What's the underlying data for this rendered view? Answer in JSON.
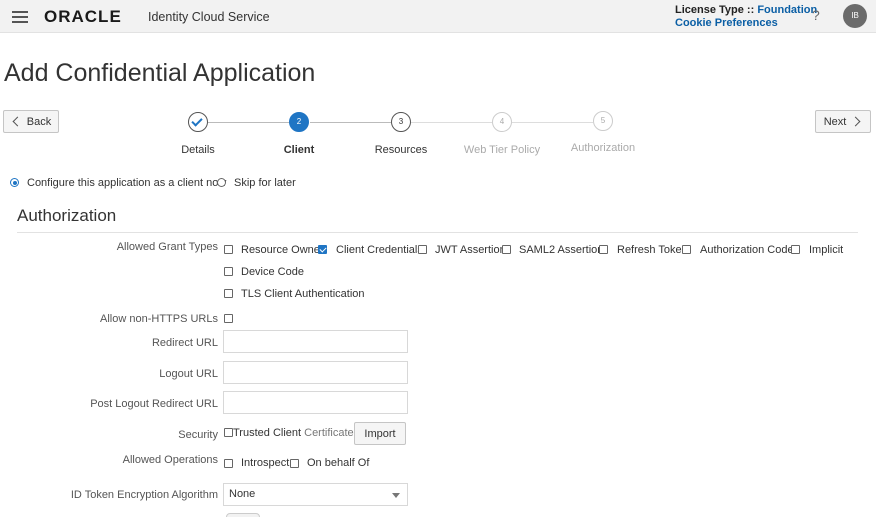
{
  "header": {
    "brand": "ORACLE",
    "service": "Identity Cloud Service",
    "license_label": "License Type :: ",
    "license_value": "Foundation",
    "cookie_link": "Cookie Preferences",
    "help": "?",
    "avatar_initials": "IB"
  },
  "page": {
    "title": "Add Confidential Application"
  },
  "nav": {
    "back": "Back",
    "next": "Next"
  },
  "steps": [
    {
      "number": "1",
      "label": "Details",
      "state": "done"
    },
    {
      "number": "2",
      "label": "Client",
      "state": "active"
    },
    {
      "number": "3",
      "label": "Resources",
      "state": "pending"
    },
    {
      "number": "4",
      "label": "Web Tier Policy",
      "state": "disabled"
    },
    {
      "number": "5",
      "label": "Authorization",
      "state": "disabled"
    }
  ],
  "client_choice": {
    "configure": "Configure this application as a client now",
    "skip": "Skip for later",
    "selected": "configure"
  },
  "authorization": {
    "title": "Authorization",
    "grant_types_label": "Allowed Grant Types",
    "grant_types": [
      {
        "label": "Resource Owner",
        "checked": false
      },
      {
        "label": "Client Credentials",
        "checked": true
      },
      {
        "label": "JWT Assertion",
        "checked": false
      },
      {
        "label": "SAML2 Assertion",
        "checked": false
      },
      {
        "label": "Refresh Token",
        "checked": false
      },
      {
        "label": "Authorization Code",
        "checked": false
      },
      {
        "label": "Implicit",
        "checked": false
      },
      {
        "label": "Device Code",
        "checked": false
      },
      {
        "label": "TLS Client Authentication",
        "checked": false
      }
    ],
    "non_https_label": "Allow non-HTTPS URLs",
    "redirect_url_label": "Redirect URL",
    "logout_url_label": "Logout URL",
    "post_logout_label": "Post Logout Redirect URL",
    "security_label": "Security",
    "trusted_client": "Trusted Client",
    "certificate": "Certificate",
    "import_button": "Import",
    "operations_label": "Allowed Operations",
    "operations": [
      {
        "label": "Introspect",
        "checked": false
      },
      {
        "label": "On behalf Of",
        "checked": false
      }
    ],
    "id_token_label": "ID Token Encryption Algorithm",
    "id_token_value": "None"
  },
  "colors": {
    "accent": "#1f75c4",
    "link": "#0b5fa5",
    "header_bg": "#f2f2f2"
  }
}
